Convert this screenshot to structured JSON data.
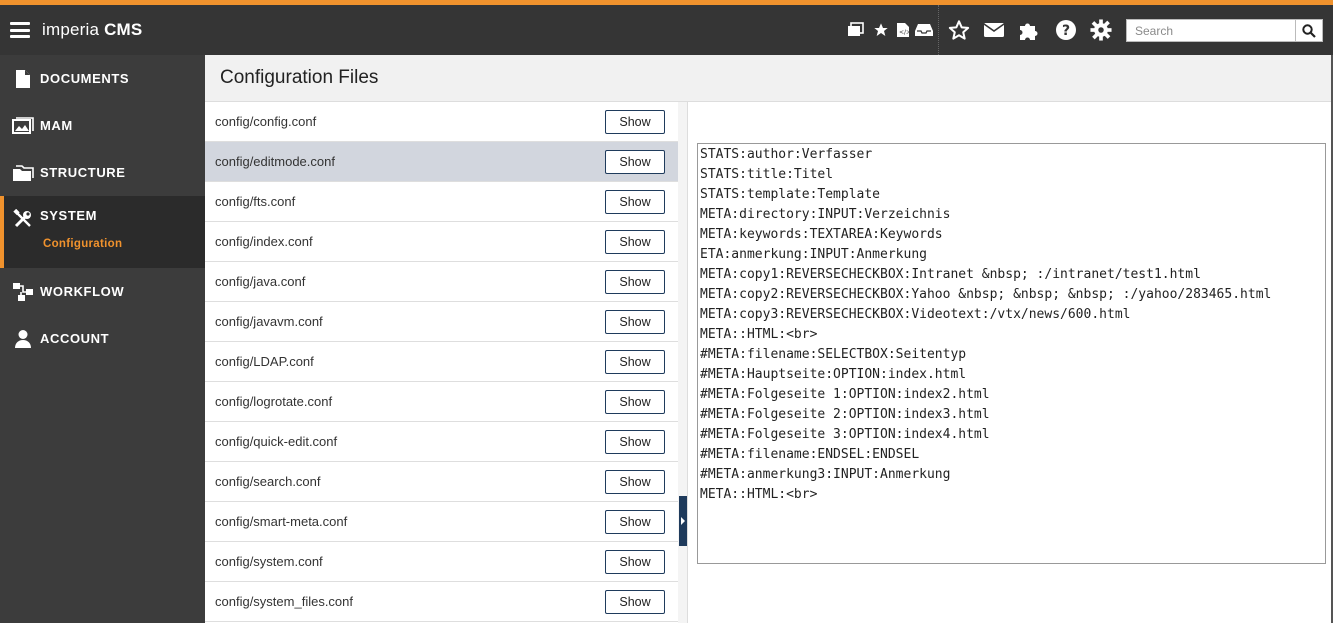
{
  "app": {
    "name_light": "imperia",
    "name_bold": "CMS"
  },
  "colors": {
    "accent": "#f0922d",
    "topbar": "#353535",
    "sidebar": "#3c3c3c",
    "button_border": "#1f3b5c"
  },
  "toolbar": {
    "icons": [
      "documents-icon",
      "favorites-star-icon",
      "script-file-icon",
      "inbox-icon",
      "bookmark-star-icon",
      "mail-icon",
      "plugin-icon",
      "help-icon",
      "settings-gear-icon"
    ]
  },
  "search": {
    "placeholder": "Search"
  },
  "sidebar": {
    "items": [
      {
        "label": "DOCUMENTS",
        "icon": "document-icon"
      },
      {
        "label": "MAM",
        "icon": "image-gallery-icon"
      },
      {
        "label": "STRUCTURE",
        "icon": "folder-icon"
      },
      {
        "label": "SYSTEM",
        "icon": "tools-icon",
        "sub": "Configuration"
      },
      {
        "label": "WORKFLOW",
        "icon": "workflow-icon"
      },
      {
        "label": "ACCOUNT",
        "icon": "user-icon"
      }
    ]
  },
  "main": {
    "title": "Configuration Files"
  },
  "files": [
    {
      "name": "config/config.conf",
      "button": "Show"
    },
    {
      "name": "config/editmode.conf",
      "button": "Show"
    },
    {
      "name": "config/fts.conf",
      "button": "Show"
    },
    {
      "name": "config/index.conf",
      "button": "Show"
    },
    {
      "name": "config/java.conf",
      "button": "Show"
    },
    {
      "name": "config/javavm.conf",
      "button": "Show"
    },
    {
      "name": "config/LDAP.conf",
      "button": "Show"
    },
    {
      "name": "config/logrotate.conf",
      "button": "Show"
    },
    {
      "name": "config/quick-edit.conf",
      "button": "Show"
    },
    {
      "name": "config/search.conf",
      "button": "Show"
    },
    {
      "name": "config/smart-meta.conf",
      "button": "Show"
    },
    {
      "name": "config/system.conf",
      "button": "Show"
    },
    {
      "name": "config/system_files.conf",
      "button": "Show"
    }
  ],
  "selected_file": "config/editmode.conf",
  "editor": {
    "content": "STATS:author:Verfasser\nSTATS:title:Titel\nSTATS:template:Template\nMETA:directory:INPUT:Verzeichnis\nMETA:keywords:TEXTAREA:Keywords\nETA:anmerkung:INPUT:Anmerkung\nMETA:copy1:REVERSECHECKBOX:Intranet &nbsp; :/intranet/test1.html\nMETA:copy2:REVERSECHECKBOX:Yahoo &nbsp; &nbsp; &nbsp; :/yahoo/283465.html\nMETA:copy3:REVERSECHECKBOX:Videotext:/vtx/news/600.html\nMETA::HTML:<br>\n#META:filename:SELECTBOX:Seitentyp\n#META:Hauptseite:OPTION:index.html\n#META:Folgeseite 1:OPTION:index2.html\n#META:Folgeseite 2:OPTION:index3.html\n#META:Folgeseite 3:OPTION:index4.html\n#META:filename:ENDSEL:ENDSEL\n#META:anmerkung3:INPUT:Anmerkung\nMETA::HTML:<br>"
  }
}
